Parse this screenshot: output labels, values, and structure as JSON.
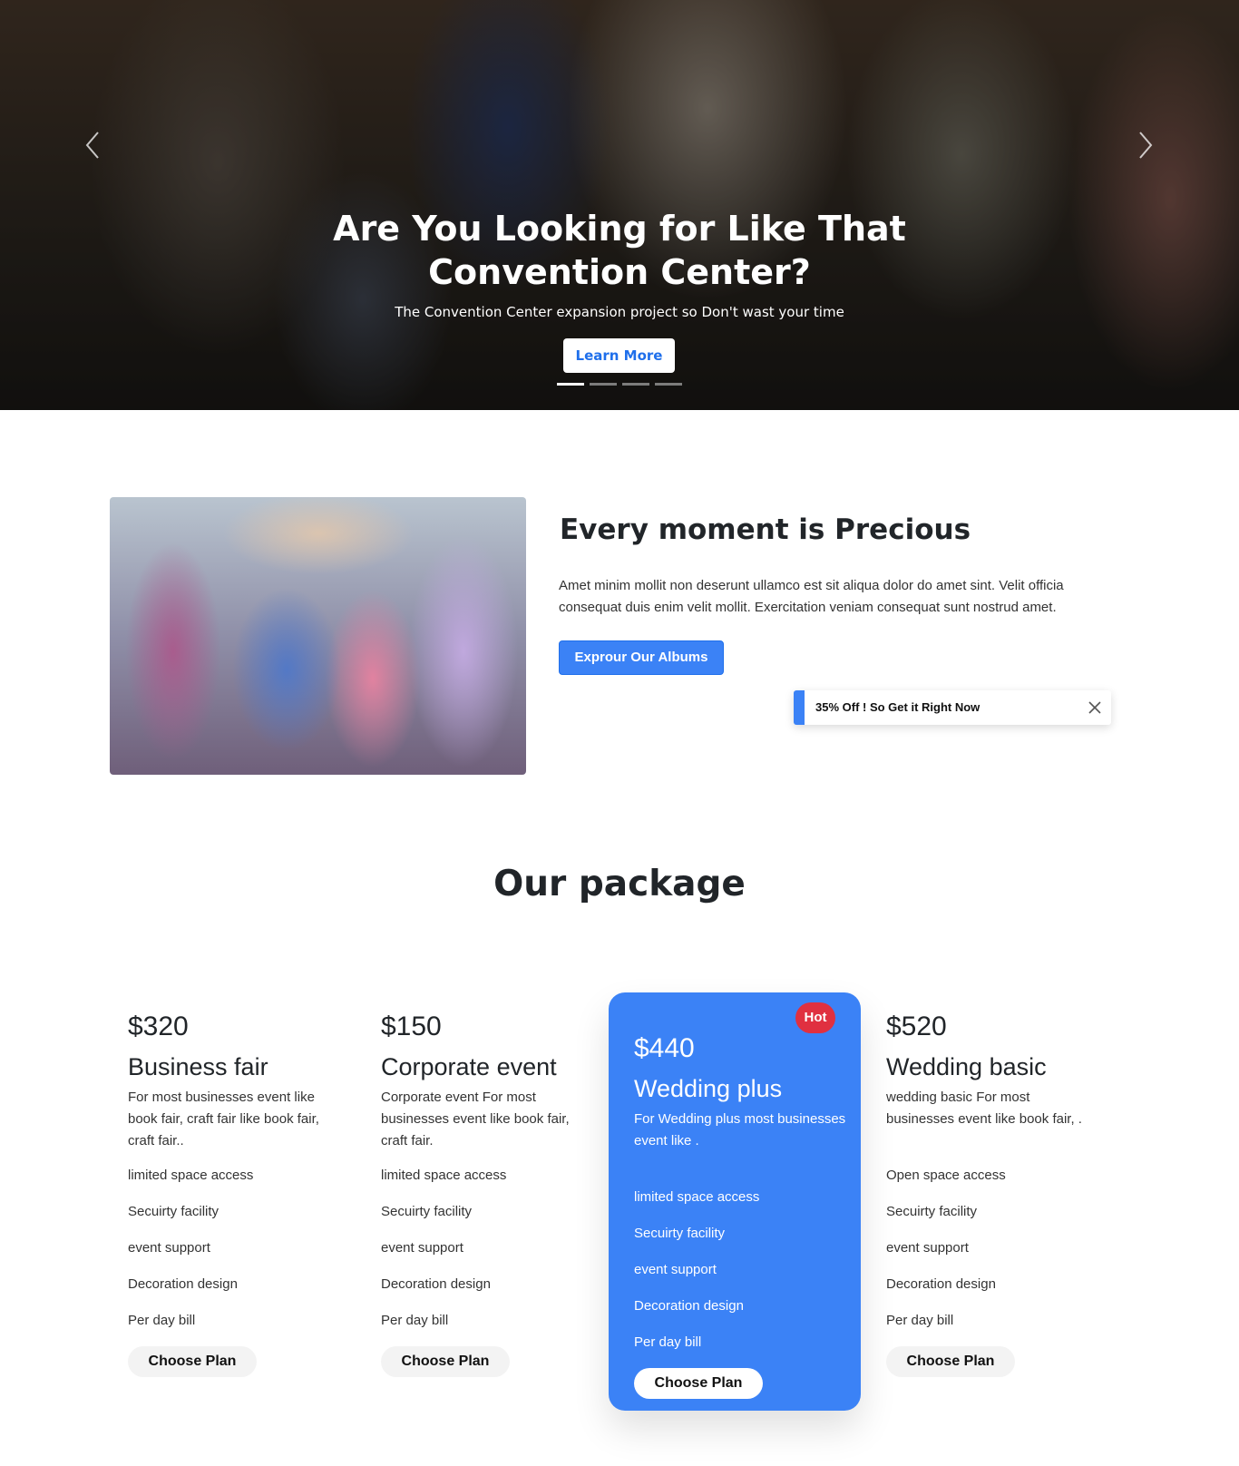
{
  "hero": {
    "title_line1": "Are You Looking for Like That",
    "title_line2": "Convention Center?",
    "subtitle": "The Convention Center expansion project so Don't wast your time",
    "button_label": "Learn More",
    "slides_count": 4,
    "active_slide": 1
  },
  "about": {
    "title": "Every moment is Precious",
    "text": "Amet minim mollit non deserunt ullamco est sit aliqua dolor do amet sint. Velit officia consequat duis enim velit mollit. Exercitation veniam consequat sunt nostrud amet.",
    "button_label": "Exprour Our Albums"
  },
  "toast": {
    "text": "35% Off ! So Get it Right Now",
    "accent": "#3b82f6"
  },
  "packages": {
    "title": "Our package",
    "choose_label": "Choose Plan",
    "hot_label": "Hot",
    "plans": [
      {
        "price": "$320",
        "name": "Business fair",
        "desc": "For most businesses event like book fair, craft fair like book fair, craft fair..",
        "features": [
          "limited space access",
          "Secuirty facility",
          "event support",
          "Decoration design",
          "Per day bill"
        ]
      },
      {
        "price": "$150",
        "name": "Corporate event",
        "desc": "Corporate event For most businesses event like book fair, craft fair.",
        "features": [
          "limited space access",
          "Secuirty facility",
          "event support",
          "Decoration design",
          "Per day bill"
        ]
      },
      {
        "price": "$440",
        "name": "Wedding plus",
        "desc": "For Wedding plus most businesses event like .",
        "features": [
          "limited space access",
          "Secuirty facility",
          "event support",
          "Decoration design",
          "Per day bill"
        ]
      },
      {
        "price": "$520",
        "name": "Wedding basic",
        "desc": "wedding basic For most businesses event like book fair, .",
        "features": [
          "Open space access",
          "Secuirty facility",
          "event support",
          "Decoration design",
          "Per day bill"
        ]
      }
    ]
  },
  "colors": {
    "primary": "#3b82f6",
    "hot": "#e03040"
  },
  "icons": {
    "prev": "chevron-left-icon",
    "next": "chevron-right-icon",
    "close": "close-icon"
  }
}
